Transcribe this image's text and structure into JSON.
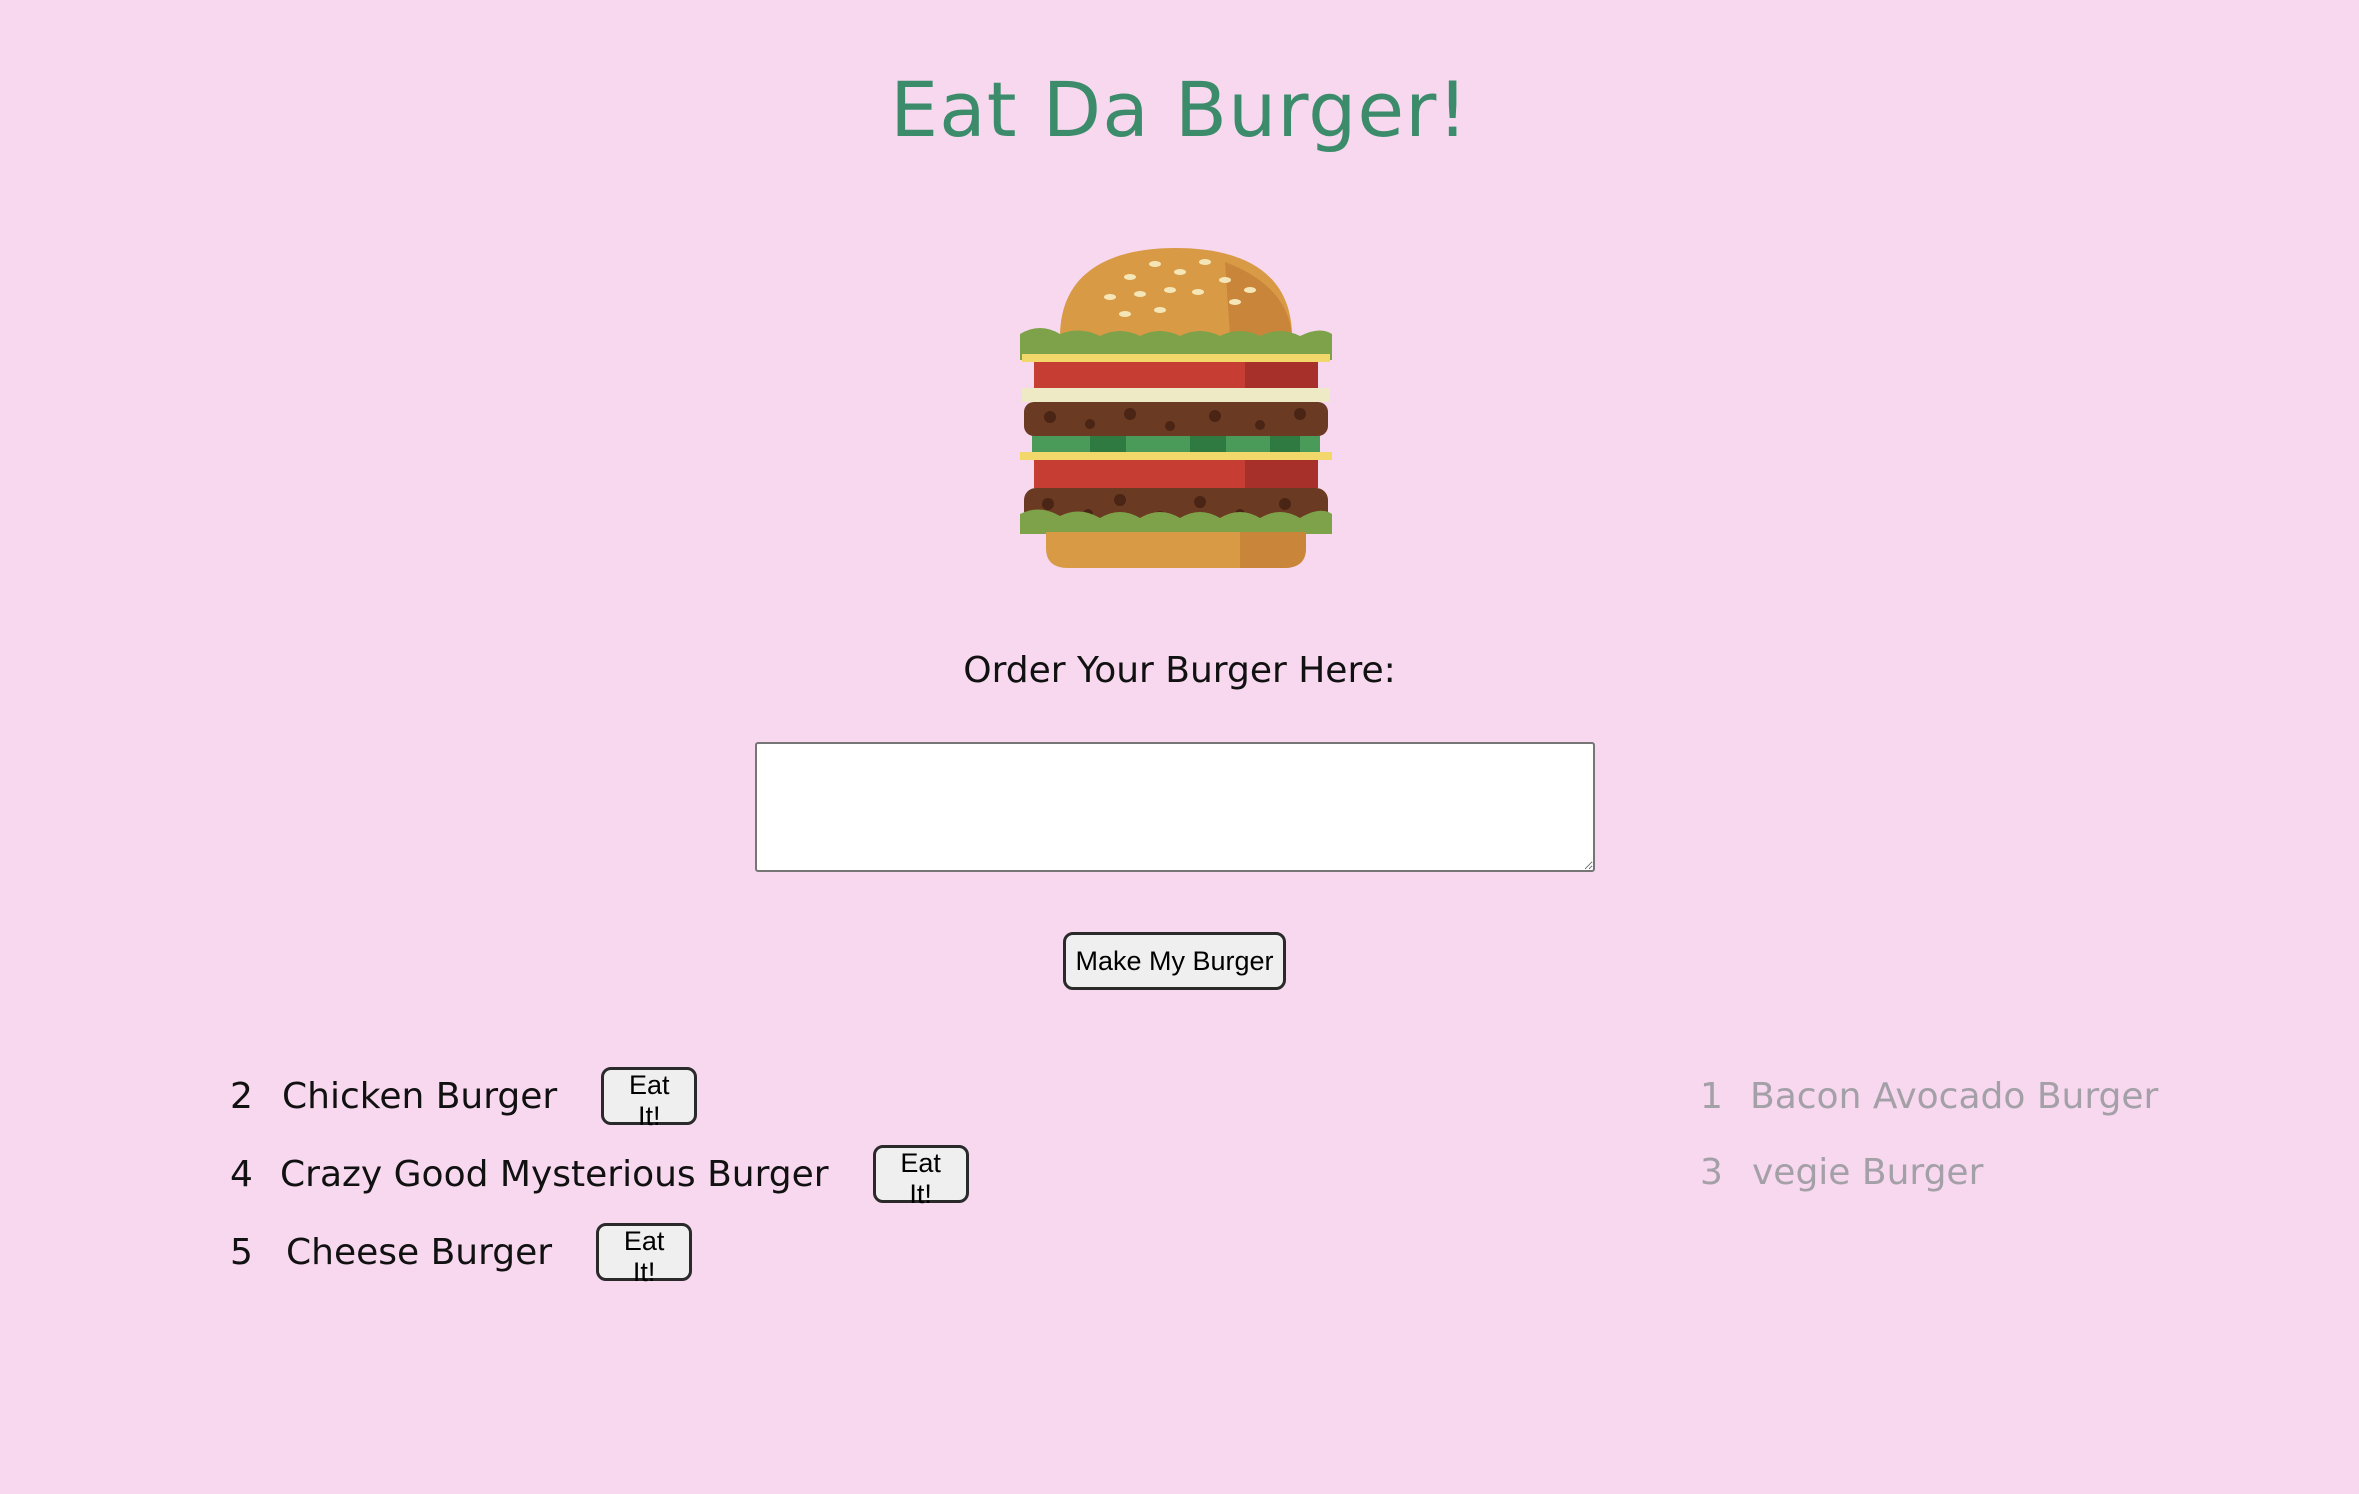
{
  "header": {
    "title": "Eat Da Burger!"
  },
  "hero": {
    "image_icon": "burger-icon"
  },
  "order_form": {
    "label": "Order Your Burger Here:",
    "input_value": "",
    "submit_label": "Make My Burger"
  },
  "uneaten_burgers": [
    {
      "id": "2",
      "name": "Chicken Burger",
      "button_label": "Eat It!"
    },
    {
      "id": "4",
      "name": "Crazy Good Mysterious Burger",
      "button_label": "Eat It!"
    },
    {
      "id": "5",
      "name": "Cheese Burger",
      "button_label": "Eat It!"
    }
  ],
  "devoured_burgers": [
    {
      "id": "1",
      "name": "Bacon Avocado Burger"
    },
    {
      "id": "3",
      "name": "vegie Burger"
    }
  ],
  "colors": {
    "background": "#f7d8ef",
    "title": "#3c8c6c",
    "devoured_text": "#a4a0a8"
  }
}
